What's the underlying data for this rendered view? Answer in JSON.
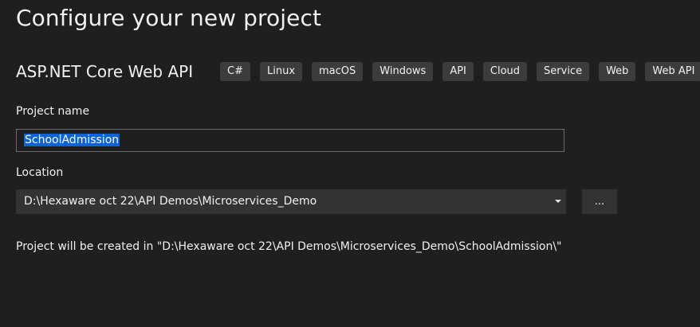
{
  "page_title": "Configure your new project",
  "template": {
    "name": "ASP.NET Core Web API",
    "tags": [
      "C#",
      "Linux",
      "macOS",
      "Windows",
      "API",
      "Cloud",
      "Service",
      "Web",
      "Web API"
    ]
  },
  "project_name": {
    "label": "Project name",
    "value": "SchoolAdmission"
  },
  "location": {
    "label": "Location",
    "value": "D:\\Hexaware oct 22\\API Demos\\Microservices_Demo",
    "browse_label": "..."
  },
  "info": "Project will be created in \"D:\\Hexaware oct 22\\API Demos\\Microservices_Demo\\SchoolAdmission\\\"",
  "colors": {
    "background": "#1f1f1f",
    "tag_background": "#3c3c3c",
    "selection": "#0e63d6"
  }
}
